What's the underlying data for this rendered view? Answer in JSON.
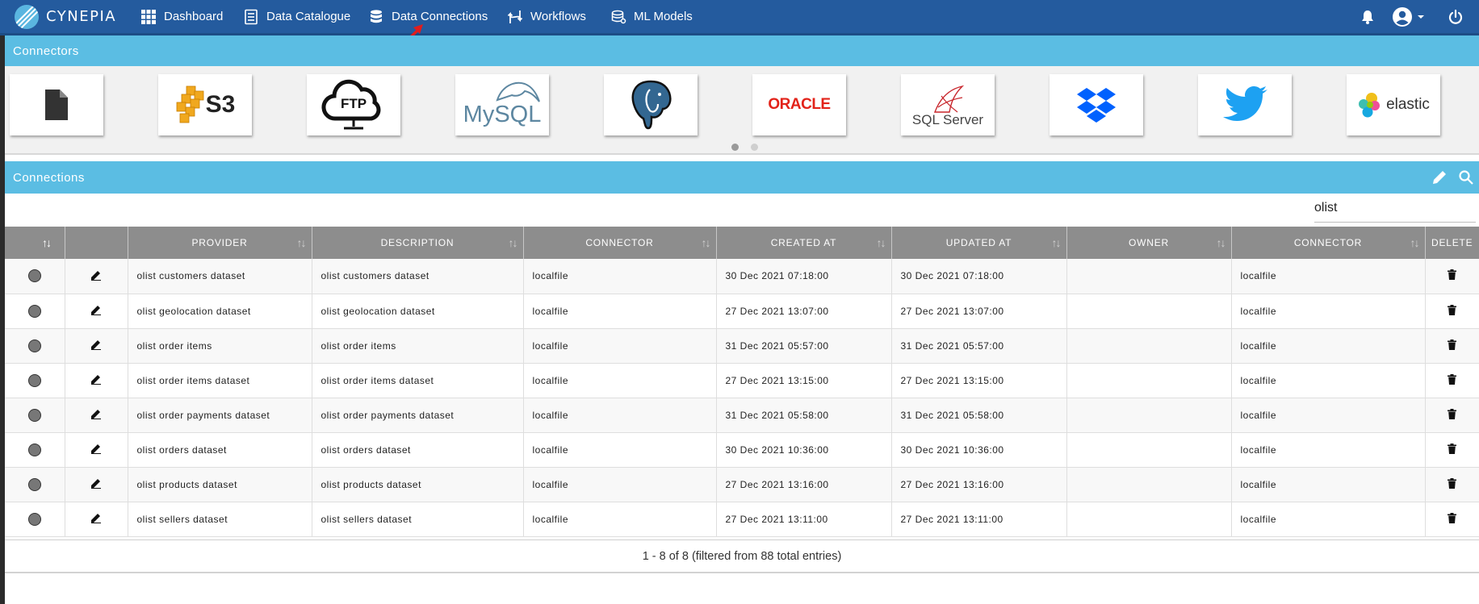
{
  "app": {
    "name": "CYNEPIA"
  },
  "nav": {
    "items": [
      {
        "label": "Dashboard",
        "icon": "grid-icon"
      },
      {
        "label": "Data Catalogue",
        "icon": "document-list-icon"
      },
      {
        "label": "Data Connections",
        "icon": "database-icon"
      },
      {
        "label": "Workflows",
        "icon": "workflow-icon"
      },
      {
        "label": "ML Models",
        "icon": "ml-models-icon"
      }
    ],
    "right_icons": [
      "bell-icon",
      "account-icon",
      "caret-down-icon",
      "power-icon"
    ]
  },
  "connectors": {
    "title": "Connectors",
    "tiles": [
      {
        "name": "localfile",
        "label": ""
      },
      {
        "name": "s3",
        "label": "S3"
      },
      {
        "name": "ftp",
        "label": "FTP"
      },
      {
        "name": "mysql",
        "label": "MySQL"
      },
      {
        "name": "postgresql",
        "label": ""
      },
      {
        "name": "oracle",
        "label": "ORACLE"
      },
      {
        "name": "sqlserver",
        "label": "SQL Server"
      },
      {
        "name": "dropbox",
        "label": ""
      },
      {
        "name": "twitter",
        "label": ""
      },
      {
        "name": "elastic",
        "label": "elastic"
      }
    ],
    "pages": 2,
    "active_page": 1
  },
  "connections": {
    "title": "Connections",
    "search_value": "olist",
    "columns": [
      "",
      "",
      "PROVIDER",
      "DESCRIPTION",
      "CONNECTOR",
      "CREATED AT",
      "UPDATED AT",
      "OWNER",
      "CONNECTOR",
      "DELETE"
    ],
    "rows": [
      {
        "provider": "olist customers dataset",
        "description": "olist customers dataset",
        "connector": "localfile",
        "created": "30 Dec 2021 07:18:00",
        "updated": "30 Dec 2021 07:18:00",
        "owner": "",
        "connector2": "localfile"
      },
      {
        "provider": "olist geolocation dataset",
        "description": "olist geolocation dataset",
        "connector": "localfile",
        "created": "27 Dec 2021 13:07:00",
        "updated": "27 Dec 2021 13:07:00",
        "owner": "",
        "connector2": "localfile"
      },
      {
        "provider": "olist order items",
        "description": "olist order items",
        "connector": "localfile",
        "created": "31 Dec 2021 05:57:00",
        "updated": "31 Dec 2021 05:57:00",
        "owner": "",
        "connector2": "localfile"
      },
      {
        "provider": "olist order items dataset",
        "description": "olist order items dataset",
        "connector": "localfile",
        "created": "27 Dec 2021 13:15:00",
        "updated": "27 Dec 2021 13:15:00",
        "owner": "",
        "connector2": "localfile"
      },
      {
        "provider": "olist order payments dataset",
        "description": "olist order payments dataset",
        "connector": "localfile",
        "created": "31 Dec 2021 05:58:00",
        "updated": "31 Dec 2021 05:58:00",
        "owner": "",
        "connector2": "localfile"
      },
      {
        "provider": "olist orders dataset",
        "description": "olist orders dataset",
        "connector": "localfile",
        "created": "30 Dec 2021 10:36:00",
        "updated": "30 Dec 2021 10:36:00",
        "owner": "",
        "connector2": "localfile"
      },
      {
        "provider": "olist products dataset",
        "description": "olist products dataset",
        "connector": "localfile",
        "created": "27 Dec 2021 13:16:00",
        "updated": "27 Dec 2021 13:16:00",
        "owner": "",
        "connector2": "localfile"
      },
      {
        "provider": "olist sellers dataset",
        "description": "olist sellers dataset",
        "connector": "localfile",
        "created": "27 Dec 2021 13:11:00",
        "updated": "27 Dec 2021 13:11:00",
        "owner": "",
        "connector2": "localfile"
      }
    ],
    "footer": "1 - 8 of 8 (filtered from 88 total entries)"
  },
  "colors": {
    "navbar": "#245b9e",
    "panel_header": "#5bbde3",
    "table_header": "#8d8d8d",
    "annotation_arrow": "#e11d1d"
  }
}
